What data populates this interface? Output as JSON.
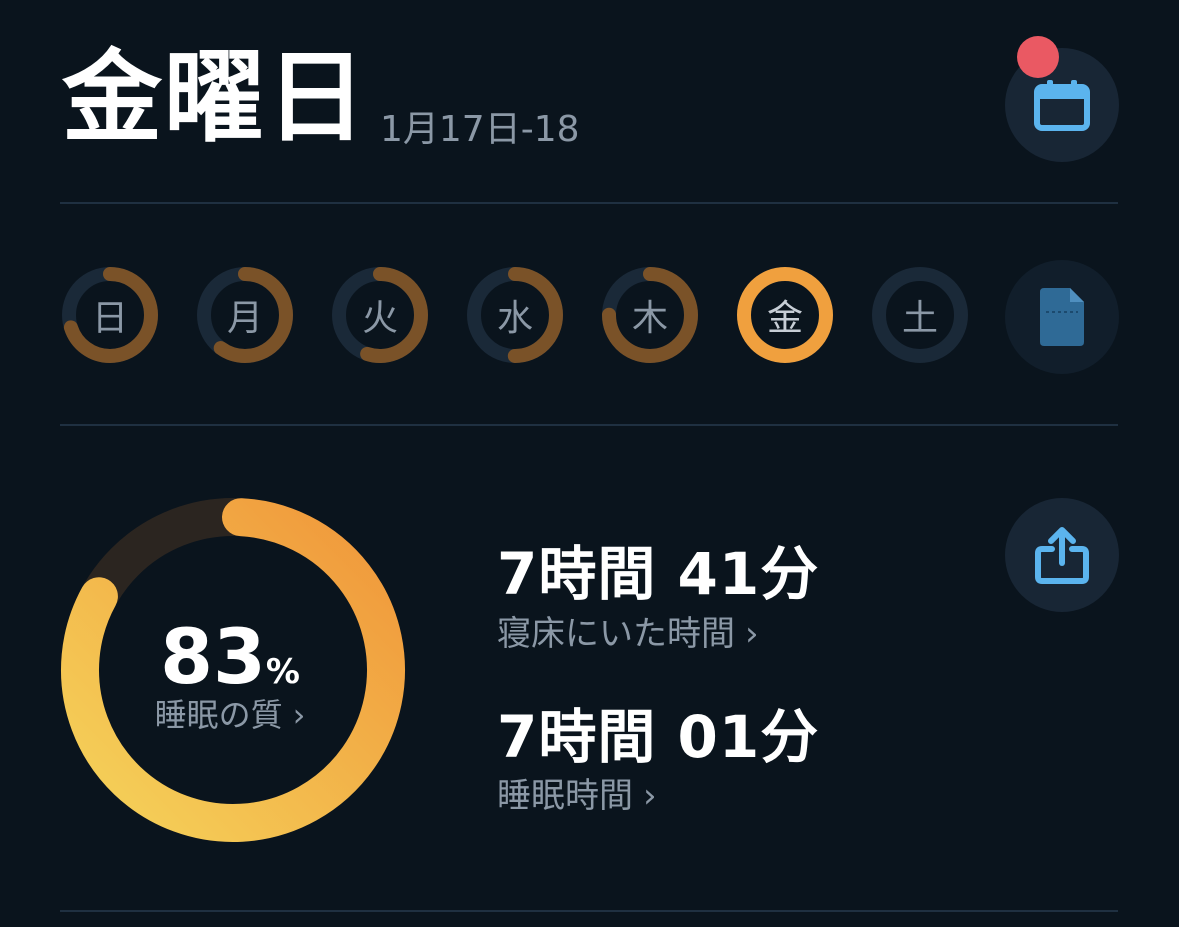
{
  "header": {
    "title": "金曜日",
    "date_range": "1月17日-18",
    "calendar_icon": "calendar-icon",
    "notification_color": "#ea5963"
  },
  "week": {
    "days": [
      {
        "label": "日",
        "score": 0.7,
        "active": false
      },
      {
        "label": "月",
        "score": 0.6,
        "active": false
      },
      {
        "label": "火",
        "score": 0.55,
        "active": false
      },
      {
        "label": "水",
        "score": 0.5,
        "active": false
      },
      {
        "label": "木",
        "score": 0.75,
        "active": false
      },
      {
        "label": "金",
        "score": 1.0,
        "active": true
      },
      {
        "label": "土",
        "score": 0,
        "active": false
      }
    ],
    "report_icon": "document-icon"
  },
  "summary": {
    "quality_value": "83",
    "quality_unit": "%",
    "quality_fraction": 0.83,
    "quality_label": "睡眠の質",
    "time_in_bed_value": "7時間 41分",
    "time_in_bed_label": "寝床にいた時間",
    "sleep_time_value": "7時間 01分",
    "sleep_time_label": "睡眠時間",
    "share_icon": "share-icon",
    "chevron": "›"
  },
  "colors": {
    "background": "#0a141d",
    "accent_orange": "#f0a03e",
    "accent_yellow": "#f5d35a",
    "muted_ring": "#7a5228",
    "icon_blue": "#5bb4ee"
  }
}
